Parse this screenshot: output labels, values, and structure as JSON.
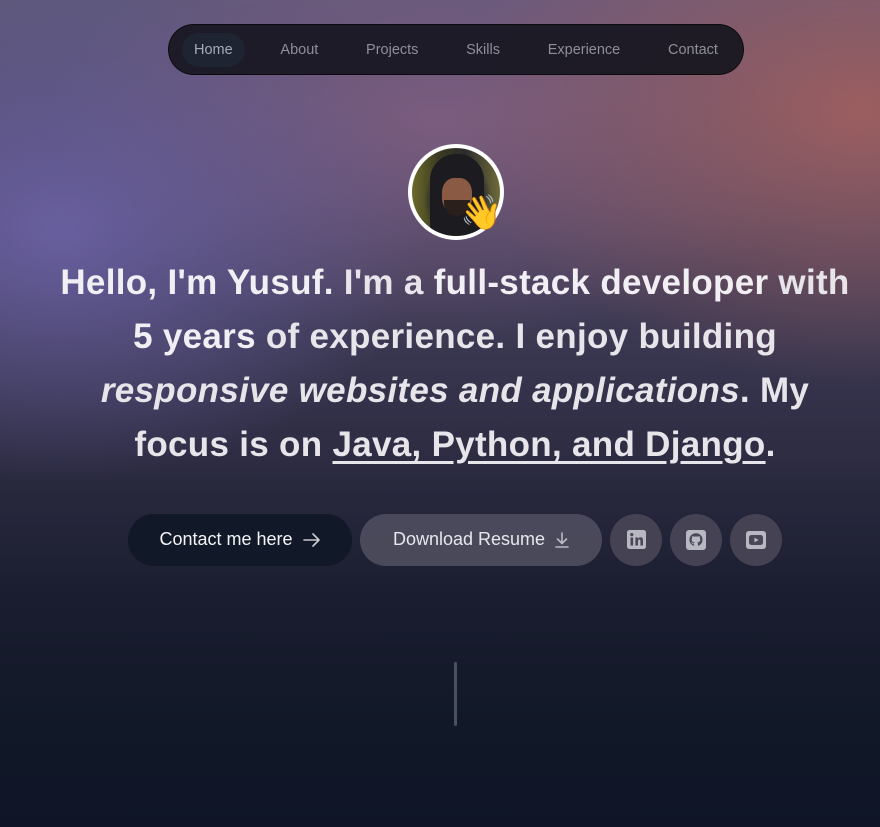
{
  "nav": {
    "items": [
      {
        "label": "Home",
        "active": true
      },
      {
        "label": "About"
      },
      {
        "label": "Projects"
      },
      {
        "label": "Skills"
      },
      {
        "label": "Experience"
      },
      {
        "label": "Contact"
      }
    ]
  },
  "hero": {
    "greeting": "Hello, I'm Yusuf.",
    "t1": " I'm a ",
    "role": "full-stack developer",
    "t2": " with ",
    "years": "5 years",
    "t3": " of experience. I enjoy building ",
    "focus_phrase": "responsive websites and applications",
    "t4": ". My focus is on ",
    "stack": "Java, Python, and Django",
    "t5": ".",
    "wave_emoji": "👋"
  },
  "actions": {
    "contact_label": "Contact me here",
    "contact_icon": "arrow-right-icon",
    "resume_label": "Download Resume",
    "resume_icon": "download-icon",
    "social": [
      "linkedin-icon",
      "github-icon",
      "youtube-icon"
    ]
  },
  "colors": {
    "primary_button": "#111827",
    "text": "#e7e5ea"
  }
}
